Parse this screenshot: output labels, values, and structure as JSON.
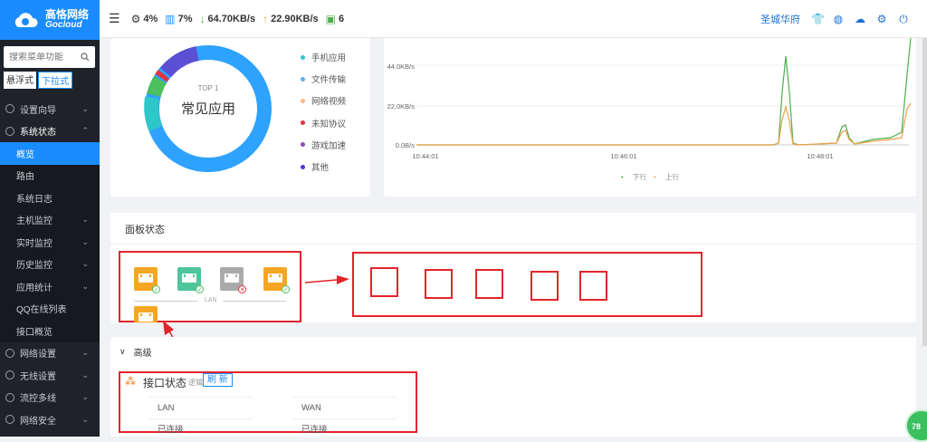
{
  "brand": {
    "name_cn": "高恪网络",
    "name_en": "Gocloud"
  },
  "search": {
    "placeholder": "搜索菜单功能"
  },
  "modes": {
    "float": "悬浮式",
    "dropdown": "下拉式"
  },
  "sidebar": {
    "items": [
      {
        "label": "设置向导",
        "level": "top"
      },
      {
        "label": "系统状态",
        "level": "top",
        "open": true
      },
      {
        "label": "概览",
        "level": "sub",
        "active": true
      },
      {
        "label": "路由",
        "level": "sub"
      },
      {
        "label": "系统日志",
        "level": "sub"
      },
      {
        "label": "主机监控",
        "level": "sub",
        "chevron": true
      },
      {
        "label": "实时监控",
        "level": "sub",
        "chevron": true
      },
      {
        "label": "历史监控",
        "level": "sub",
        "chevron": true
      },
      {
        "label": "应用统计",
        "level": "sub",
        "chevron": true
      },
      {
        "label": "QQ在线列表",
        "level": "sub"
      },
      {
        "label": "接口概览",
        "level": "sub"
      },
      {
        "label": "网络设置",
        "level": "top"
      },
      {
        "label": "无线设置",
        "level": "top"
      },
      {
        "label": "流控多线",
        "level": "top"
      },
      {
        "label": "网络安全",
        "level": "top"
      }
    ]
  },
  "topbar": {
    "cpu": "4%",
    "mem": "7%",
    "down": "64.70KB/s",
    "up": "22.90KB/s",
    "hosts": "6",
    "user": "圣城华府"
  },
  "donut": {
    "top_label": "TOP 1",
    "center_label": "常见应用",
    "legend": [
      {
        "label": "手机应用",
        "color": "#2ec7c9"
      },
      {
        "label": "文件传输",
        "color": "#5ab1ef"
      },
      {
        "label": "网络视频",
        "color": "#ffb980"
      },
      {
        "label": "未知协议",
        "color": "#e5323e"
      },
      {
        "label": "游戏加速",
        "color": "#8d4bbb"
      },
      {
        "label": "其他",
        "color": "#4b3ad4"
      }
    ]
  },
  "chart_data": {
    "type": "line",
    "x_ticks": [
      "10:44:01",
      "10:46:01",
      "10:48:01"
    ],
    "y_ticks": [
      "44.0KB/s",
      "22.0KB/s",
      "0.0B/s"
    ],
    "series": [
      {
        "name": "下行",
        "color": "#4cae4c"
      },
      {
        "name": "上行",
        "color": "#f0a04b"
      }
    ]
  },
  "panel": {
    "title": "面板状态",
    "lan_label": "LAN"
  },
  "advanced": {
    "title": "高级"
  },
  "iface": {
    "title": "接口状态",
    "subtitle": "逻辑",
    "refresh": "刷 新",
    "lan_header": "LAN",
    "lan_status": "已连接",
    "wan_header": "WAN",
    "wan_status": "已连接"
  },
  "float_badge": "78"
}
